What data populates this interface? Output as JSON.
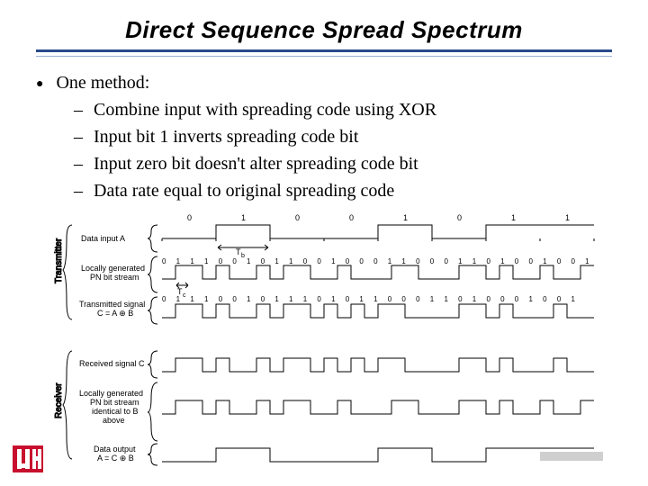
{
  "title": "Direct Sequence Spread Spectrum",
  "bullet": "One method:",
  "sub": [
    "Combine input with spreading code using XOR",
    "Input bit 1 inverts spreading code bit",
    "Input zero bit doesn't alter spreading code bit",
    "Data rate equal to original spreading code"
  ],
  "diagram": {
    "transmitter_label": "Transmitter",
    "receiver_label": "Receiver",
    "row1": "Data input A",
    "row2a": "Locally generated",
    "row2b": "PN bit stream",
    "row3a": "Transmitted signal",
    "row3b": "C = A ⊕ B",
    "row4": "Received signal C",
    "row5a": "Locally generated",
    "row5b": "PN bit stream",
    "row5c": "identical to B",
    "row5d": "above",
    "row6a": "Data output",
    "row6b": "A = C ⊕ B",
    "Tb": "T",
    "Tc": "T",
    "data_bits": [
      "0",
      "1",
      "0",
      "0",
      "1",
      "0",
      "1",
      "1"
    ],
    "pn_bits": "0 1 1  1 0 0 1 0 1 1  0 0 1 0 0 0 1 1  0 0 0 1 1 0 1 0 0 1 0 0 1",
    "tx_bits": "0 1 1  1 0 0 1 0 1 1  1 0 1 0 1 1  0 0 0 1 1 0 1 0 0 0 1 0 0 1"
  }
}
